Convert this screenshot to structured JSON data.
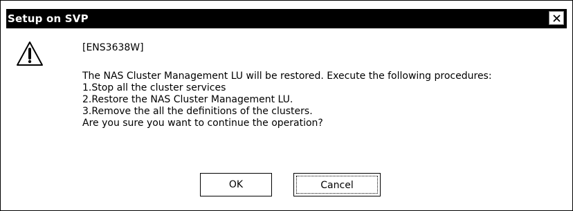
{
  "window": {
    "title": "Setup on SVP",
    "close_icon": "close-icon"
  },
  "message": {
    "icon": "warning-icon",
    "code": "[ENS3638W]",
    "lines": [
      "The NAS Cluster Management LU will be restored. Execute the following procedures:",
      "1.Stop all the cluster services",
      "2.Restore the NAS Cluster Management LU.",
      "3.Remove the all the definitions of the clusters.",
      "Are you sure you want to continue the operation?"
    ]
  },
  "buttons": {
    "ok_label": "OK",
    "cancel_label": "Cancel"
  }
}
